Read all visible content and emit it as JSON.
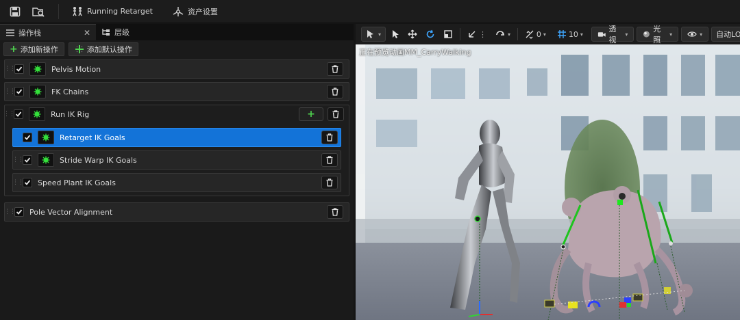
{
  "toolbar": {
    "save_icon": "save-icon",
    "browse_icon": "browse-asset-icon",
    "running_retarget_label": "Running Retarget",
    "asset_settings_label": "资产设置"
  },
  "left_panel": {
    "tabs": [
      {
        "label": "操作栈",
        "active": true
      },
      {
        "label": "层级",
        "active": false
      }
    ],
    "actions": {
      "add_new_label": "添加新操作",
      "add_default_label": "添加默认操作"
    },
    "operations": [
      {
        "label": "Pelvis Motion",
        "checked": true
      },
      {
        "label": "FK Chains",
        "checked": true
      },
      {
        "label": "Run IK Rig",
        "checked": true,
        "children": [
          {
            "label": "Retarget IK Goals",
            "checked": true,
            "selected": true
          },
          {
            "label": "Stride Warp IK Goals",
            "checked": true
          },
          {
            "label": "Speed Plant IK Goals",
            "checked": true
          }
        ]
      },
      {
        "label": "Pole Vector Alignment",
        "checked": true
      }
    ]
  },
  "viewport": {
    "toolbar": {
      "snap_rotation_value": "0",
      "grid_value": "10",
      "perspective_label": "透视",
      "lighting_label": "光照",
      "auto_label": "自动LOD"
    },
    "preview_text": "正在预览动画MM_CarryWalking"
  },
  "colors": {
    "accent": "#1373d8",
    "gear_green": "#33e03a",
    "panel_bg": "#1a1a1a"
  }
}
